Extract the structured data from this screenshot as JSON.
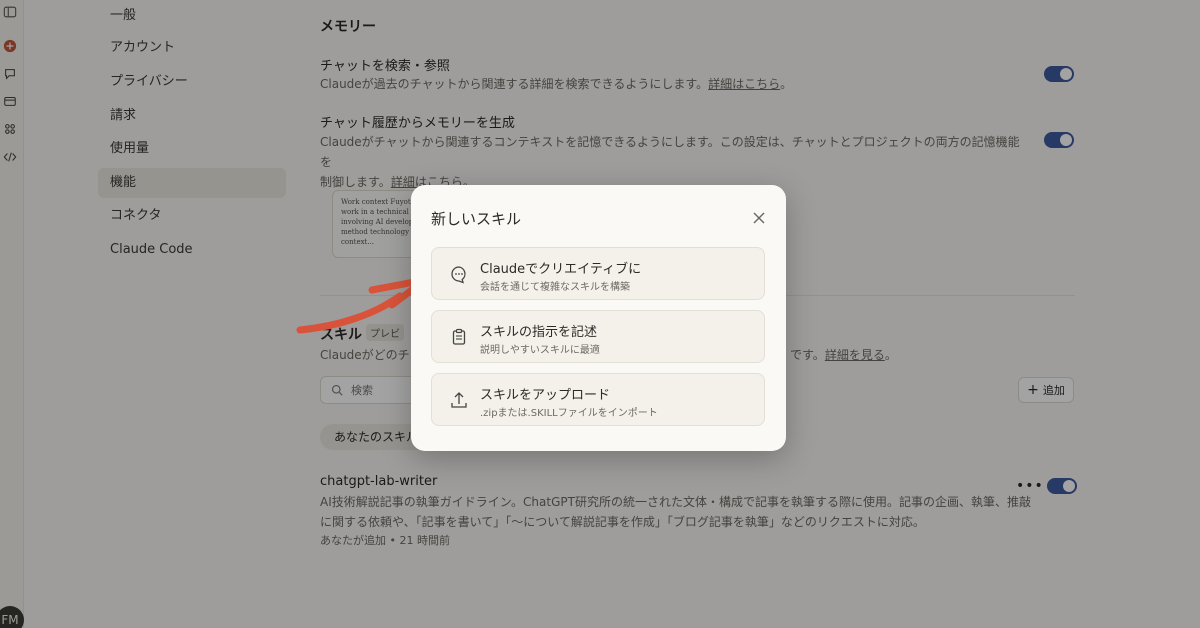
{
  "nav": {
    "items": [
      {
        "label": "一般"
      },
      {
        "label": "アカウント"
      },
      {
        "label": "プライバシー"
      },
      {
        "label": "請求"
      },
      {
        "label": "使用量"
      },
      {
        "label": "機能"
      },
      {
        "label": "コネクタ"
      },
      {
        "label": "Claude Code"
      }
    ],
    "active": "機能"
  },
  "memory": {
    "title": "メモリー",
    "search_chats": {
      "title": "チャットを検索・参照",
      "desc": "Claudeが過去のチャットから関連する詳細を検索できるようにします。",
      "link": "詳細はこちら",
      "enabled": true
    },
    "generate_memory": {
      "title": "チャット履歴からメモリーを生成",
      "desc_line1": "Claudeがチャットから関連するコンテキストを記憶できるようにします。この設定は、チャットとプロジェクトの両方の記憶機能を",
      "desc_line2": "制御します。",
      "link": "詳細はこちら",
      "enabled": true
    },
    "card_lines": [
      "Work context Fuyota",
      "work in a technical ro",
      "involving AI develop",
      "method technology",
      "context..."
    ]
  },
  "skills_section": {
    "title": "スキル",
    "badge": "プレビ",
    "desc_left": "Claudeがどのチ",
    "desc_right": "です。",
    "desc_link": "詳細を見る",
    "desc_end": "。",
    "search_placeholder": "検索",
    "add_label": "追加",
    "filter_label": "あなたのスキル",
    "skill": {
      "name": "chatgpt-lab-writer",
      "desc": "AI技術解説記事の執筆ガイドライン。ChatGPT研究所の統一された文体・構成で記事を執筆する際に使用。記事の企画、執筆、推敲に関する依頼や、「記事を書いて」「〜について解説記事を作成」「ブログ記事を執筆」などのリクエストに対応。",
      "meta": "あなたが追加 • 21 時間前",
      "enabled": true
    }
  },
  "modal": {
    "title": "新しいスキル",
    "options": [
      {
        "title": "Claudeでクリエイティブに",
        "subtitle": "会話を通じて複雑なスキルを構築",
        "icon": "chat-bubble-icon"
      },
      {
        "title": "スキルの指示を記述",
        "subtitle": "説明しやすいスキルに最適",
        "icon": "clipboard-icon"
      },
      {
        "title": "スキルをアップロード",
        "subtitle": ".zipまたは.SKILLファイルをインポート",
        "icon": "upload-icon"
      }
    ]
  },
  "user": {
    "initials": "FM"
  },
  "colors": {
    "toggle_on": "#3d5a9e",
    "arrow": "#d9533a"
  }
}
